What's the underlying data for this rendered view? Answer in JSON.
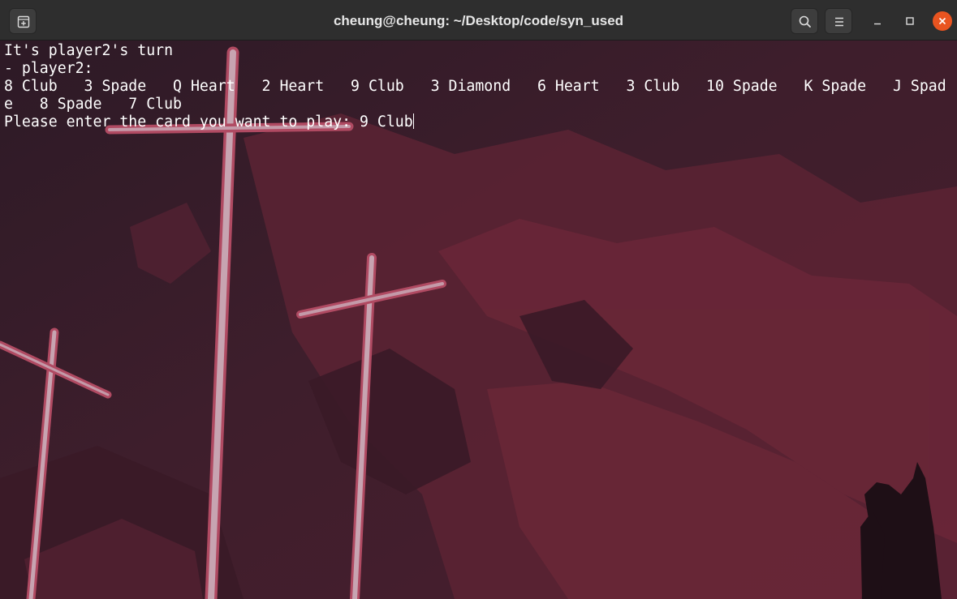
{
  "window": {
    "title": "cheung@cheung: ~/Desktop/code/syn_used",
    "icons": {
      "new_tab": "new-tab-icon",
      "search": "search-icon",
      "menu": "hamburger-menu-icon",
      "minimize": "minimize-icon",
      "maximize": "maximize-icon",
      "close": "close-icon"
    },
    "accent_close": "#e95420",
    "titlebar_color": "#2e2e2e"
  },
  "terminal": {
    "lines": [
      "It's player2's turn",
      "- player2:",
      "8 Club   3 Spade   Q Heart   2 Heart   9 Club   3 Diamond   6 Heart   3 Club   10 Spade   K Spade   J Spad",
      "e   8 Spade   7 Club"
    ],
    "prompt": "Please enter the card you want to play: ",
    "input_value": "9 Club",
    "text_color": "#ffffff"
  }
}
